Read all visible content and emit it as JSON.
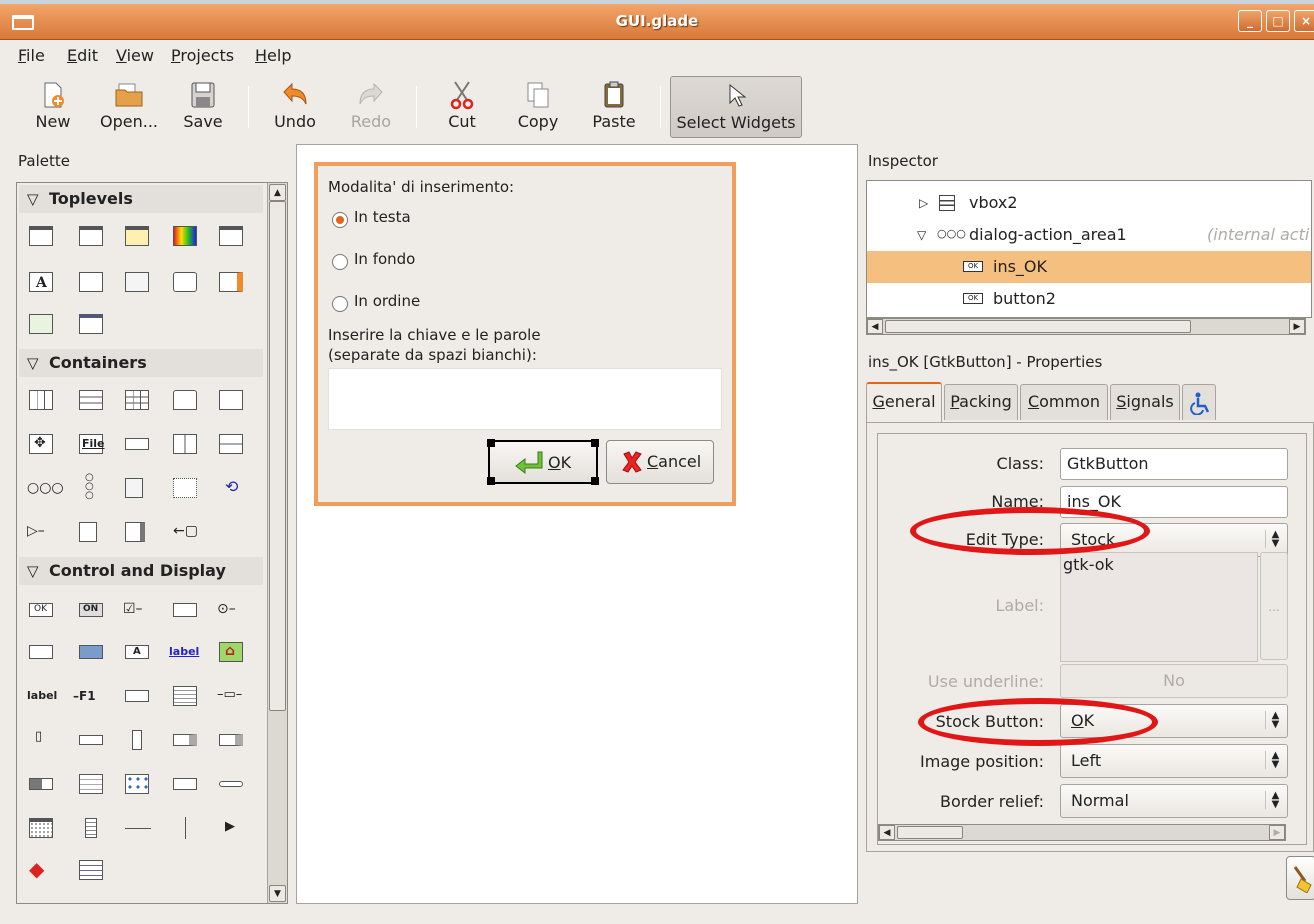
{
  "window": {
    "title": "GUI.glade"
  },
  "menubar": {
    "items": [
      {
        "pre": "",
        "u": "F",
        "post": "ile"
      },
      {
        "pre": "",
        "u": "E",
        "post": "dit"
      },
      {
        "pre": "",
        "u": "V",
        "post": "iew"
      },
      {
        "pre": "",
        "u": "P",
        "post": "rojects"
      },
      {
        "pre": "",
        "u": "H",
        "post": "elp"
      }
    ]
  },
  "toolbar": {
    "new": "New",
    "open": "Open...",
    "save": "Save",
    "undo": "Undo",
    "redo": "Redo",
    "cut": "Cut",
    "copy": "Copy",
    "paste": "Paste",
    "select_widgets": "Select Widgets"
  },
  "palette": {
    "label": "Palette",
    "sections": {
      "toplevels": "Toplevels",
      "containers": "Containers",
      "control": "Control and Display"
    },
    "texts": {
      "file": "File",
      "label_link": "label",
      "label_plain": "label",
      "f1": "F1",
      "ok": "OK",
      "on": "ON",
      "a": "A"
    }
  },
  "dialog": {
    "heading": "Modalita' di inserimento:",
    "radios": [
      {
        "label": "In testa",
        "checked": true
      },
      {
        "label": "In fondo",
        "checked": false
      },
      {
        "label": "In ordine",
        "checked": false
      }
    ],
    "instructions_1": "Inserire la chiave e le parole",
    "instructions_2": "(separate da spazi bianchi):",
    "ok_u": "O",
    "ok_rest": "K",
    "cancel_u": "C",
    "cancel_rest": "ancel"
  },
  "inspector": {
    "label": "Inspector",
    "tree": [
      {
        "name": "vbox2",
        "note": ""
      },
      {
        "name": "dialog-action_area1",
        "note": "(internal acti"
      },
      {
        "name": "ins_OK",
        "note": "",
        "selected": true
      },
      {
        "name": "button2",
        "note": ""
      }
    ],
    "properties_title": "ins_OK [GtkButton] - Properties",
    "tabs": [
      {
        "u": "G",
        "rest": "eneral"
      },
      {
        "u": "P",
        "rest": "acking"
      },
      {
        "u": "C",
        "rest": "ommon"
      },
      {
        "u": "S",
        "rest": "ignals"
      }
    ],
    "props": {
      "class_label": "Class:",
      "class_value": "GtkButton",
      "name_label": "Name:",
      "name_value": "ins_OK",
      "edit_type_label": "Edit Type:",
      "edit_type_value": "Stock",
      "label_label": "Label:",
      "label_value": "gtk-ok",
      "dots": "...",
      "use_underline_label": "Use underline:",
      "use_underline_value": "No",
      "stock_label": "Stock Button:",
      "stock_value_u": "O",
      "stock_value_rest": "K",
      "image_position_label": "Image position:",
      "image_position_value": "Left",
      "border_relief_label": "Border relief:",
      "border_relief_value": "Normal"
    }
  },
  "colors": {
    "accent": "#e0661c",
    "title_bar": "#d9783a",
    "highlight_ellipse": "#e11616",
    "selection": "#f5c07f"
  }
}
